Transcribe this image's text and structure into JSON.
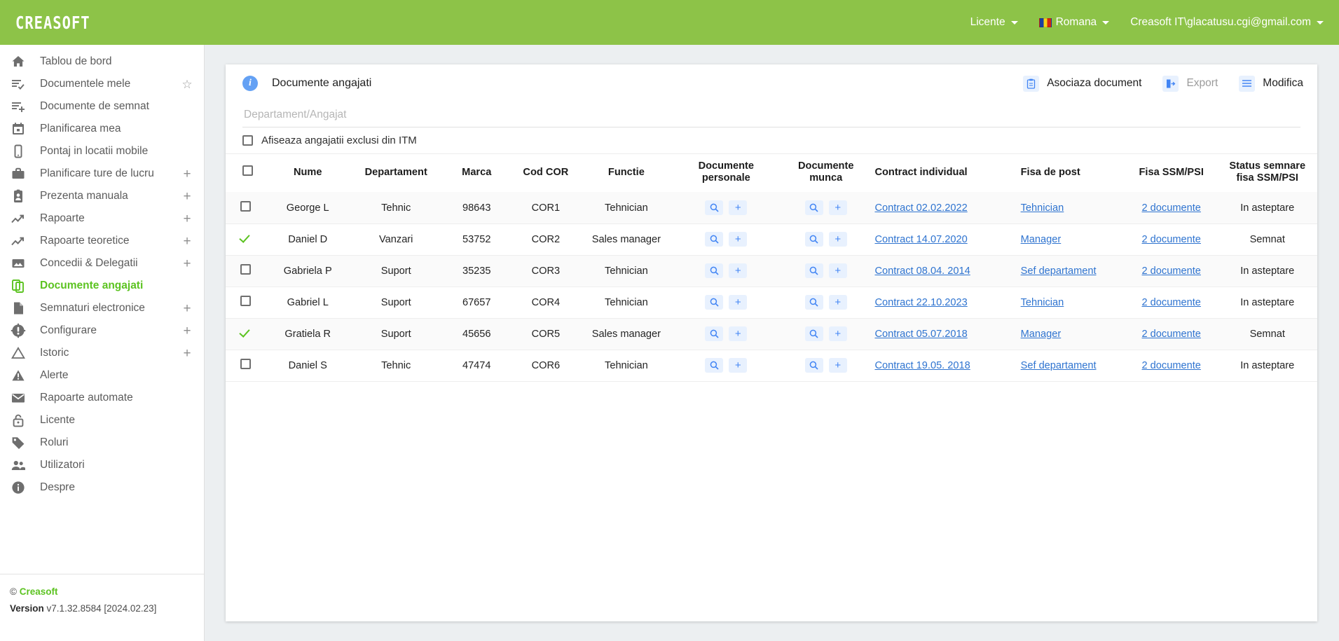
{
  "topbar": {
    "brand": "CREASOFT",
    "nav": [
      {
        "label": "Licente",
        "icon": "chevron-down-icon",
        "flag": false
      },
      {
        "label": "Romana",
        "icon": "chevron-down-icon",
        "flag": true
      },
      {
        "label": "Creasoft IT\\glacatusu.cgi@gmail.com",
        "icon": "chevron-down-icon",
        "flag": false
      }
    ]
  },
  "sidebar": {
    "items": [
      {
        "label": "Tablou de bord",
        "icon": "home-icon",
        "extra": "",
        "active": false
      },
      {
        "label": "Documentele mele",
        "icon": "list-check-icon",
        "extra": "star",
        "active": false
      },
      {
        "label": "Documente de semnat",
        "icon": "list-plus-icon",
        "extra": "",
        "active": false
      },
      {
        "label": "Planificarea mea",
        "icon": "calendar-icon",
        "extra": "",
        "active": false
      },
      {
        "label": "Pontaj in locatii mobile",
        "icon": "mobile-icon",
        "extra": "",
        "active": false
      },
      {
        "label": "Planificare ture de lucru",
        "icon": "briefcase-icon",
        "extra": "plus",
        "active": false
      },
      {
        "label": "Prezenta manuala",
        "icon": "badge-icon",
        "extra": "plus",
        "active": false
      },
      {
        "label": "Rapoarte",
        "icon": "trend-icon",
        "extra": "plus",
        "active": false
      },
      {
        "label": "Rapoarte teoretice",
        "icon": "trend-icon",
        "extra": "plus",
        "active": false
      },
      {
        "label": "Concedii & Delegatii",
        "icon": "image-icon",
        "extra": "plus",
        "active": false
      },
      {
        "label": "Documente angajati",
        "icon": "copy-docs-icon",
        "extra": "",
        "active": true
      },
      {
        "label": "Semnaturi electronice",
        "icon": "document-icon",
        "extra": "plus",
        "active": false
      },
      {
        "label": "Configurare",
        "icon": "gear-icon",
        "extra": "plus",
        "active": false
      },
      {
        "label": "Istoric",
        "icon": "triangle-icon",
        "extra": "plus",
        "active": false
      },
      {
        "label": "Alerte",
        "icon": "warning-icon",
        "extra": "",
        "active": false
      },
      {
        "label": "Rapoarte automate",
        "icon": "mail-icon",
        "extra": "",
        "active": false
      },
      {
        "label": "Licente",
        "icon": "lock-icon",
        "extra": "",
        "active": false
      },
      {
        "label": "Roluri",
        "icon": "tag-icon",
        "extra": "",
        "active": false
      },
      {
        "label": "Utilizatori",
        "icon": "users-icon",
        "extra": "",
        "active": false
      },
      {
        "label": "Despre",
        "icon": "info-icon",
        "extra": "",
        "active": false
      }
    ],
    "footer": {
      "copyright_symbol": "©",
      "copyright_name": "Creasoft",
      "version_label": "Version",
      "version_value": "v7.1.32.8584 [2024.02.23]"
    }
  },
  "main": {
    "title": "Documente angajati",
    "info_icon": "info-icon",
    "actions": [
      {
        "label": "Asociaza document",
        "icon": "clipboard-icon",
        "dim": false
      },
      {
        "label": "Export",
        "icon": "export-icon",
        "dim": true
      },
      {
        "label": "Modifica",
        "icon": "menu-icon",
        "dim": false
      }
    ],
    "filter": {
      "placeholder": "Departament/Angajat",
      "value": ""
    },
    "itm_checkbox": {
      "label": "Afiseaza angajatii exclusi din ITM",
      "checked": false
    },
    "columns": [
      "",
      "Nume",
      "Departament",
      "Marca",
      "Cod COR",
      "Functie",
      "Documente personale",
      "Documente munca",
      "Contract individual",
      "Fisa de post",
      "Fisa SSM/PSI",
      "Status semnare fisa SSM/PSI"
    ],
    "columns_ssm_line1": "Status semnare",
    "columns_ssm_line2": "fisa SSM/PSI",
    "rows": [
      {
        "selected": false,
        "nume": "George L",
        "departament": "Tehnic",
        "marca": "98643",
        "cod_cor": "COR1",
        "functie": "Tehnician",
        "contract": "Contract 02.02.2022",
        "fisa_post": "Tehnician",
        "fisa_ssm": "2 documente",
        "status": "In asteptare",
        "status_type": "wait"
      },
      {
        "selected": true,
        "nume": "Daniel D",
        "departament": "Vanzari",
        "marca": "53752",
        "cod_cor": "COR2",
        "functie": "Sales manager",
        "contract": "Contract 14.07.2020",
        "fisa_post": "Manager",
        "fisa_ssm": "2 documente",
        "status": "Semnat",
        "status_type": "signed"
      },
      {
        "selected": false,
        "nume": "Gabriela P",
        "departament": "Suport",
        "marca": "35235",
        "cod_cor": "COR3",
        "functie": "Tehnician",
        "contract": "Contract 08.04. 2014",
        "fisa_post": "Sef departament",
        "fisa_ssm": "2 documente",
        "status": "In asteptare",
        "status_type": "wait"
      },
      {
        "selected": false,
        "nume": "Gabriel L",
        "departament": "Suport",
        "marca": "67657",
        "cod_cor": "COR4",
        "functie": "Tehnician",
        "contract": "Contract 22.10.2023",
        "fisa_post": "Tehnician",
        "fisa_ssm": "2 documente",
        "status": "In asteptare",
        "status_type": "wait"
      },
      {
        "selected": true,
        "nume": "Gratiela R",
        "departament": "Suport",
        "marca": "45656",
        "cod_cor": "COR5",
        "functie": "Sales manager",
        "contract": "Contract 05.07.2018",
        "fisa_post": "Manager",
        "fisa_ssm": "2 documente",
        "status": "Semnat",
        "status_type": "signed"
      },
      {
        "selected": false,
        "nume": "Daniel S",
        "departament": "Tehnic",
        "marca": "47474",
        "cod_cor": "COR6",
        "functie": "Tehnician",
        "contract": "Contract 19.05. 2018",
        "fisa_post": "Sef departament",
        "fisa_ssm": "2 documente",
        "status": "In asteptare",
        "status_type": "wait"
      }
    ],
    "row_actions": {
      "search_icon": "search-icon",
      "add_icon": "plus-icon"
    }
  },
  "colors": {
    "brand_green": "#8dc348",
    "active_green": "#5cc321",
    "link_blue": "#2f74d0",
    "accent_blue": "#4285f4",
    "status_wait": "#f0a53a",
    "status_signed": "#46a832"
  }
}
